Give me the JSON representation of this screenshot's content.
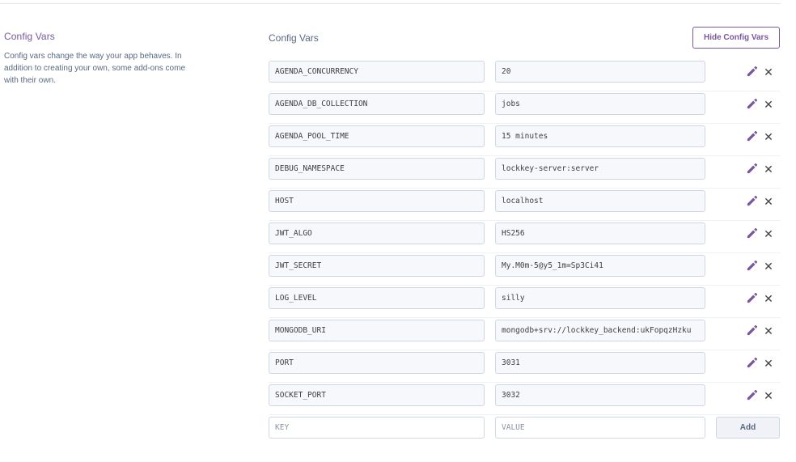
{
  "left": {
    "title": "Config Vars",
    "description": "Config vars change the way your app behaves. In addition to creating your own, some add-ons come with their own."
  },
  "main": {
    "title": "Config Vars",
    "hide_button_label": "Hide Config Vars",
    "vars": [
      {
        "key": "AGENDA_CONCURRENCY",
        "value": "20"
      },
      {
        "key": "AGENDA_DB_COLLECTION",
        "value": "jobs"
      },
      {
        "key": "AGENDA_POOL_TIME",
        "value": "15 minutes"
      },
      {
        "key": "DEBUG_NAMESPACE",
        "value": "lockkey-server:server"
      },
      {
        "key": "HOST",
        "value": "localhost"
      },
      {
        "key": "JWT_ALGO",
        "value": "HS256"
      },
      {
        "key": "JWT_SECRET",
        "value": "My.M0m-5@y5_1m=Sp3Ci41"
      },
      {
        "key": "LOG_LEVEL",
        "value": "silly"
      },
      {
        "key": "MONGODB_URI",
        "value": "mongodb+srv://lockkey_backend:ukFopqzHzku"
      },
      {
        "key": "PORT",
        "value": "3031"
      },
      {
        "key": "SOCKET_PORT",
        "value": "3032"
      }
    ],
    "new_var": {
      "key_placeholder": "KEY",
      "value_placeholder": "VALUE",
      "add_button_label": "Add"
    }
  },
  "colors": {
    "accent": "#79589f",
    "text": "#3f3f44",
    "muted": "#596981",
    "field_border": "#cfd7e6"
  },
  "icons": {
    "edit": "pencil-icon",
    "remove": "close-icon"
  }
}
